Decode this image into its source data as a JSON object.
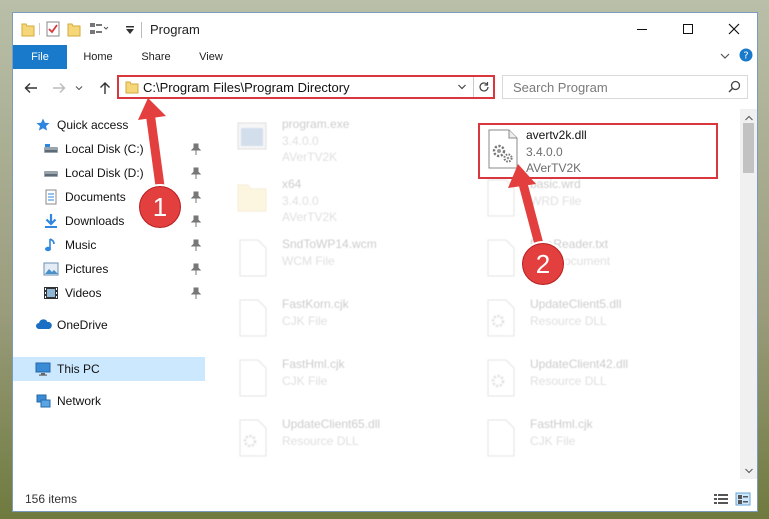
{
  "window": {
    "title": "Program"
  },
  "ribbon": {
    "tabs": [
      "File",
      "Home",
      "Share",
      "View"
    ]
  },
  "address": {
    "path": "C:\\Program Files\\Program Directory"
  },
  "search": {
    "placeholder": "Search Program"
  },
  "sidebar": {
    "items": [
      {
        "label": "Quick access",
        "icon": "star-icon"
      },
      {
        "label": "Local Disk (C:)",
        "icon": "drive-icon",
        "pinned": true
      },
      {
        "label": "Local Disk (D:)",
        "icon": "drive-icon",
        "pinned": true
      },
      {
        "label": "Documents",
        "icon": "documents-icon",
        "pinned": true
      },
      {
        "label": "Downloads",
        "icon": "download-icon",
        "pinned": true
      },
      {
        "label": "Music",
        "icon": "music-icon",
        "pinned": true
      },
      {
        "label": "Pictures",
        "icon": "pictures-icon",
        "pinned": true
      },
      {
        "label": "Videos",
        "icon": "video-icon",
        "pinned": true
      },
      {
        "label": "OneDrive",
        "icon": "cloud-icon"
      },
      {
        "label": "This PC",
        "icon": "computer-icon",
        "selected": true
      },
      {
        "label": "Network",
        "icon": "network-icon"
      }
    ]
  },
  "files": [
    {
      "name": "program.exe",
      "line2": "3.4.0.0",
      "line3": "AVerTV2K",
      "icon": "exe-icon",
      "faded": true
    },
    {
      "name": "avertv2k.dll",
      "line2": "3.4.0.0",
      "line3": "AVerTV2K",
      "icon": "dll-gear-icon",
      "highlighted": true
    },
    {
      "name": "x64",
      "line2": "3.4.0.0",
      "line3": "AVerTV2K",
      "icon": "folder-icon",
      "faded": true
    },
    {
      "name": "basic.wrd",
      "line2": "WRD File",
      "line3": "",
      "icon": "blank-file-icon",
      "faded": true
    },
    {
      "name": "SndToWP14.wcm",
      "line2": "WCM File",
      "line3": "",
      "icon": "blank-file-icon",
      "faded": true
    },
    {
      "name": "FineReader.txt",
      "line2": "Text Document",
      "line3": "",
      "icon": "blank-file-icon",
      "faded": true
    },
    {
      "name": "FastKorn.cjk",
      "line2": "CJK File",
      "line3": "",
      "icon": "blank-file-icon",
      "faded": true
    },
    {
      "name": "UpdateClient5.dll",
      "line2": "Resource DLL",
      "line3": "",
      "icon": "dll-gear-icon",
      "faded": true
    },
    {
      "name": "FastHml.cjk",
      "line2": "CJK File",
      "line3": "",
      "icon": "blank-file-icon",
      "faded": true
    },
    {
      "name": "UpdateClient42.dll",
      "line2": "Resource DLL",
      "line3": "",
      "icon": "dll-gear-icon",
      "faded": true
    },
    {
      "name": "UpdateClient65.dll",
      "line2": "Resource DLL",
      "line3": "",
      "icon": "dll-gear-icon",
      "faded": true
    },
    {
      "name": "FastHml.cjk",
      "line2": "CJK File",
      "line3": "",
      "icon": "blank-file-icon",
      "faded": true
    }
  ],
  "status": {
    "items_count": "156 items"
  },
  "callouts": [
    {
      "label": "1"
    },
    {
      "label": "2"
    }
  ],
  "colors": {
    "accent": "#1979ca",
    "highlight": "#d9363e",
    "callout": "#e43f3f",
    "selected": "#cce8ff"
  }
}
